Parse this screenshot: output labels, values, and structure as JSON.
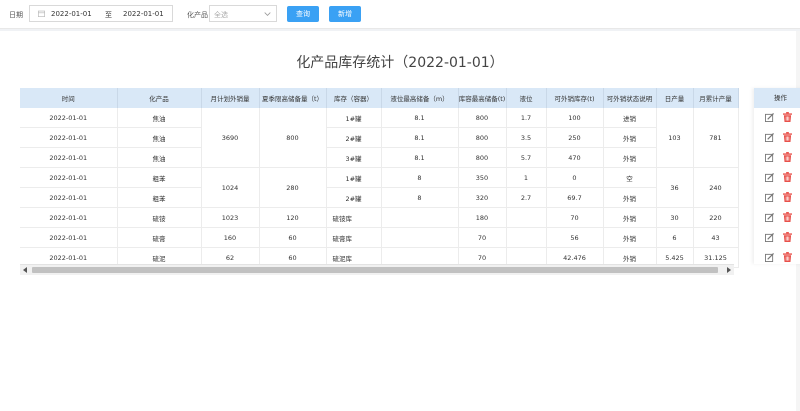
{
  "filters": {
    "date_label": "日期",
    "date_start": "2022-01-01",
    "date_sep": "至",
    "date_end": "2022-01-01",
    "product_label": "化产品",
    "product_value": "全选"
  },
  "buttons": {
    "query": "查询",
    "add": "新增"
  },
  "report": {
    "title": "化产品库存统计（2022-01-01）"
  },
  "table": {
    "headers": [
      "时间",
      "化产品",
      "月计划外销量",
      "夏季限高储备量（t）",
      "库存（容器）",
      "液位最高储备（m）",
      "库容最高储备(t)",
      "液位",
      "可外销库存(t)",
      "可外销状态说明",
      "日产量",
      "月累计产量"
    ],
    "op_header": "操作",
    "rows": [
      [
        "2022-01-01",
        "焦油",
        "",
        "",
        "1#罐",
        "8.1",
        "800",
        "1.7",
        "100",
        "进销",
        "",
        ""
      ],
      [
        "2022-01-01",
        "焦油",
        "3690",
        "800",
        "2#罐",
        "8.1",
        "800",
        "3.5",
        "250",
        "外销",
        "103",
        "781"
      ],
      [
        "2022-01-01",
        "焦油",
        "",
        "",
        "3#罐",
        "8.1",
        "800",
        "5.7",
        "470",
        "外销",
        "",
        ""
      ],
      [
        "2022-01-01",
        "粗苯",
        "",
        "",
        "1#罐",
        "8",
        "350",
        "1",
        "0",
        "空",
        "",
        ""
      ],
      [
        "2022-01-01",
        "粗苯",
        "1024",
        "280",
        "2#罐",
        "8",
        "320",
        "2.7",
        "69.7",
        "外销",
        "36",
        "240"
      ],
      [
        "2022-01-01",
        "硫铵",
        "1023",
        "120",
        "硫铵库",
        "",
        "180",
        "",
        "70",
        "外销",
        "30",
        "220"
      ],
      [
        "2022-01-01",
        "硫膏",
        "160",
        "60",
        "硫膏库",
        "",
        "70",
        "",
        "56",
        "外销",
        "6",
        "43"
      ],
      [
        "2022-01-01",
        "硫泥",
        "62",
        "60",
        "硫泥库",
        "",
        "70",
        "",
        "42.476",
        "外销",
        "5.425",
        "31.125"
      ]
    ]
  },
  "icons": {
    "edit": "edit-icon",
    "delete": "trash-icon",
    "calendar": "calendar-icon",
    "dropdown": "chevron-down-icon"
  },
  "colors": {
    "accent": "#3aa1f4",
    "header_bg": "#d9e8f7",
    "delete": "#e8504a"
  }
}
